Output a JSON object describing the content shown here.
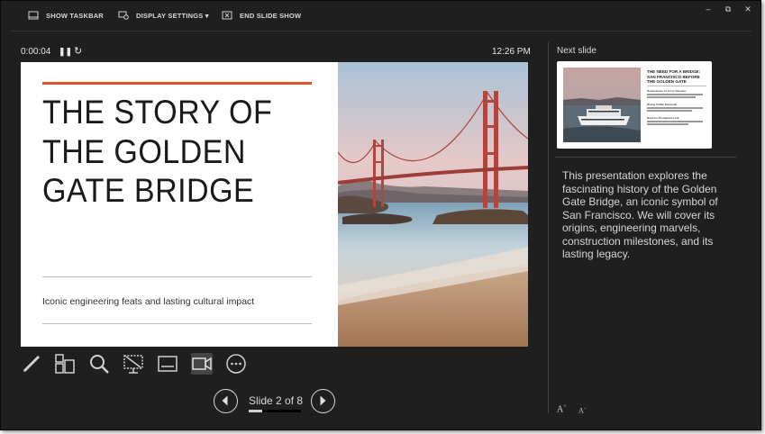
{
  "toolbar": {
    "show_taskbar": "SHOW TASKBAR",
    "display_settings": "DISPLAY SETTINGS ▾",
    "end_slide_show": "END SLIDE SHOW"
  },
  "window_controls": {
    "minimize": "–",
    "restore": "⧉",
    "close": "✕"
  },
  "timer": {
    "elapsed": "0:00:04",
    "pause_icon": "pause-icon",
    "restart_icon": "restart-icon"
  },
  "clock": "12:26 PM",
  "current_slide": {
    "title_line1": "THE STORY OF",
    "title_line2": "THE GOLDEN",
    "title_line3": "GATE BRIDGE",
    "subtitle": "Iconic engineering feats and lasting cultural impact",
    "accent_color": "#e0512c"
  },
  "tools": [
    "pen-icon",
    "see-all-slides-icon",
    "zoom-icon",
    "black-screen-icon",
    "subtitles-icon",
    "camera-icon",
    "more-options-icon"
  ],
  "navigation": {
    "counter": "Slide 2 of 8",
    "progress": 0.25
  },
  "next_slide": {
    "label": "Next slide",
    "title_line1": "THE NEED FOR A BRIDGE:",
    "title_line2": "SAN FRANCISCO BEFORE",
    "title_line3": "THE GOLDEN GATE",
    "heading1": "Dependence on Ferry Services",
    "heading2": "Rising Traffic Demands",
    "heading3": "Need for Permanent Link"
  },
  "notes": "This presentation explores the fascinating history of the Golden Gate Bridge, an iconic symbol of San Francisco. We will cover its origins, engineering marvels, construction milestones, and its lasting legacy.",
  "font_size": {
    "increase": "A",
    "decrease": "A"
  }
}
